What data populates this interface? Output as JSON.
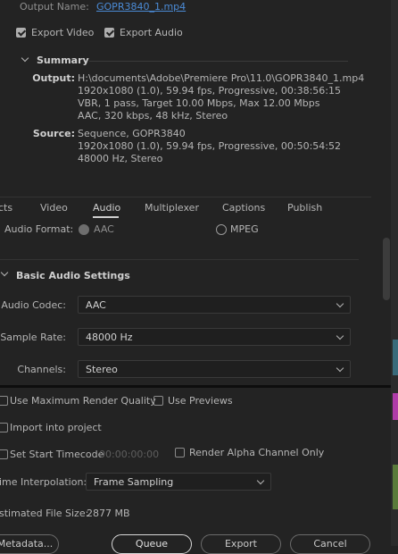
{
  "output": {
    "name_label": "Output Name:",
    "name_value": "GOPR3840_1.mp4",
    "export_video": "Export Video",
    "export_audio": "Export Audio"
  },
  "summary": {
    "title": "Summary",
    "output_label": "Output:",
    "output_lines": [
      "H:\\documents\\Adobe\\Premiere Pro\\11.0\\GOPR3840_1.mp4",
      "1920x1080 (1.0), 59.94 fps, Progressive, 00:38:56:15",
      "VBR, 1 pass, Target 10.00 Mbps, Max 12.00 Mbps",
      "AAC, 320 kbps, 48 kHz, Stereo"
    ],
    "source_label": "Source:",
    "source_lines": [
      "Sequence, GOPR3840",
      "1920x1080 (1.0), 59.94 fps, Progressive, 00:50:54:52",
      "48000 Hz, Stereo"
    ]
  },
  "tabs": [
    "cts",
    "Video",
    "Audio",
    "Multiplexer",
    "Captions",
    "Publish"
  ],
  "audio_format": {
    "label": "Audio Format:",
    "option_aac": "AAC",
    "option_mpeg": "MPEG"
  },
  "basic_audio": {
    "title": "Basic Audio Settings",
    "codec_label": "Audio Codec:",
    "codec_value": "AAC",
    "rate_label": "Sample Rate:",
    "rate_value": "48000 Hz",
    "channels_label": "Channels:",
    "channels_value": "Stereo"
  },
  "options": {
    "max_quality": "Use Maximum Render Quality",
    "use_previews": "Use Previews",
    "import_project": "Import into project",
    "start_timecode": "Set Start Timecode",
    "timecode_value": "00:00:00:00",
    "alpha_only": "Render Alpha Channel Only",
    "interp_label": "ime Interpolation:",
    "interp_value": "Frame Sampling",
    "filesize_label": "stimated File Size:",
    "filesize_value": "2877 MB"
  },
  "buttons": {
    "metadata": "Metadata...",
    "queue": "Queue",
    "export": "Export",
    "cancel": "Cancel"
  },
  "colors": {
    "background": "#232323",
    "link": "#4b8bd6",
    "active_tab_underline": "#d0d0d0"
  }
}
